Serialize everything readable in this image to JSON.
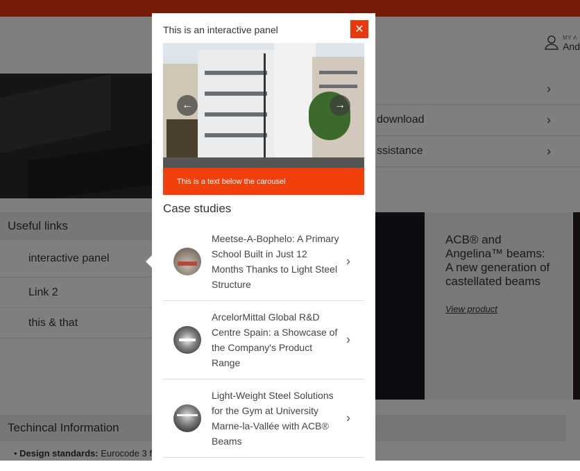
{
  "header": {
    "user_small": "MY A",
    "user_name": "And"
  },
  "right_list": [
    {
      "label": ""
    },
    {
      "label": "download"
    },
    {
      "label": "ssistance"
    }
  ],
  "useful_links": {
    "title": "Useful links",
    "items": [
      {
        "label": "interactive panel"
      },
      {
        "label": "Link 2"
      },
      {
        "label": "this & that"
      }
    ]
  },
  "product_card": {
    "title": "ACB® and Angelina™ beams: A new generation of castellated beams",
    "link": "View product"
  },
  "technical": {
    "title": "Techincal Information",
    "design_standards_label": "Design standards:",
    "design_standards_value": "Eurocode 3 f"
  },
  "panel": {
    "title": "This is an interactive panel",
    "close": "✕",
    "carousel_prev": "←",
    "carousel_next": "→",
    "carousel_caption": "This is a text below the carousel",
    "case_studies_title": "Case studies",
    "case_studies": [
      {
        "title": "Meetse-A-Bophelo: A Primary School Built in Just 12 Months Thanks to Light Steel Structure"
      },
      {
        "title": "ArcelorMittal Global R&D Centre Spain: a Showcase of the Company's Product Range"
      },
      {
        "title": "Light-Weight Steel Solutions for the Gym at University Marne-la-Vallée with ACB® Beams"
      }
    ]
  },
  "colors": {
    "accent": "#e8380d",
    "caption_bg": "#f2400a",
    "overlay": "rgba(0,0,0,0.5)"
  },
  "icons": {
    "user": "user-icon",
    "chevron": "chevron-right-icon",
    "close": "close-icon",
    "arrow_left": "arrow-left-icon",
    "arrow_right": "arrow-right-icon"
  }
}
